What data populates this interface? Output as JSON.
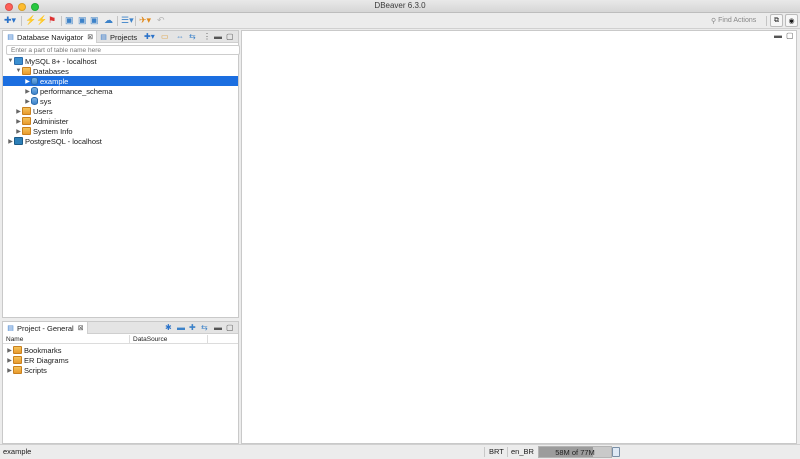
{
  "window": {
    "title": "DBeaver 6.3.0"
  },
  "colors": {
    "selection": "#1b6ee0",
    "close": "#ff5f57",
    "minimize": "#febc2e",
    "zoom": "#28c840"
  },
  "toolbar": {
    "icons": [
      "new-connection-icon",
      "connect-icon",
      "disconnect-icon",
      "invalidate-icon",
      "commit-icon",
      "rollback-icon",
      "transaction-mode-icon",
      "sql-editor-icon",
      "navigate-icon",
      "run-icon",
      "undo-icon"
    ],
    "find_actions": "Find Actions"
  },
  "navigator": {
    "tabs": [
      {
        "label": "Database Navigator",
        "active": true
      },
      {
        "label": "Projects",
        "active": false
      }
    ],
    "filter_placeholder": "Enter a part of table name here",
    "tree": [
      {
        "label": "MySQL 8+ - localhost",
        "level": 0,
        "expanded": true,
        "icon": "mysql-connection-icon"
      },
      {
        "label": "Databases",
        "level": 1,
        "expanded": true,
        "icon": "folder-icon"
      },
      {
        "label": "example",
        "level": 2,
        "expanded": false,
        "icon": "database-icon",
        "selected": true
      },
      {
        "label": "performance_schema",
        "level": 2,
        "expanded": false,
        "icon": "database-icon"
      },
      {
        "label": "sys",
        "level": 2,
        "expanded": false,
        "icon": "database-icon"
      },
      {
        "label": "Users",
        "level": 1,
        "expanded": false,
        "icon": "folder-icon"
      },
      {
        "label": "Administer",
        "level": 1,
        "expanded": false,
        "icon": "folder-icon"
      },
      {
        "label": "System Info",
        "level": 1,
        "expanded": false,
        "icon": "folder-icon"
      },
      {
        "label": "PostgreSQL - localhost",
        "level": 0,
        "expanded": false,
        "icon": "postgresql-connection-icon"
      }
    ]
  },
  "project": {
    "tab_label": "Project - General",
    "columns": [
      "Name",
      "DataSource"
    ],
    "items": [
      {
        "label": "Bookmarks"
      },
      {
        "label": "ER Diagrams"
      },
      {
        "label": "Scripts"
      }
    ]
  },
  "statusbar": {
    "selection": "example",
    "timezone": "BRT",
    "locale": "en_BR",
    "memory": "58M of 77M",
    "memory_used_fraction": 0.75
  }
}
